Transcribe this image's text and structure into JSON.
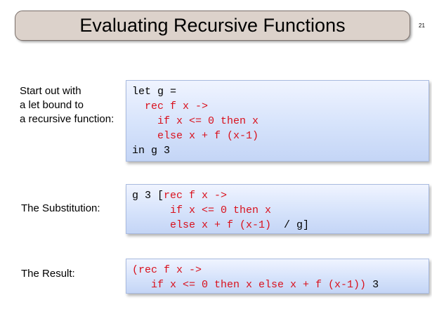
{
  "slide": {
    "title": "Evaluating Recursive Functions",
    "page_number": "21"
  },
  "section1": {
    "label_lines": [
      "Start out with",
      "a let bound to",
      "a recursive function:"
    ],
    "code": {
      "l1a": "let g =",
      "l2a": "  rec f x ->",
      "l3a": "    if x <= 0 then x",
      "l4a": "    else x + f (x-1)",
      "l5a": "in g 3"
    }
  },
  "section2": {
    "label": "The Substitution:",
    "code": {
      "l1a": "g 3 [",
      "l1b": "rec f x ->",
      "l2a": "      if x <= 0 then x",
      "l3a": "      else x + f (x-1)",
      "l3b": "  / g]"
    }
  },
  "section3": {
    "label": "The Result:",
    "code": {
      "l1a": "(rec f x ->",
      "l2a": "   if x <= 0 then x else x + f (x-1))",
      "l2b": " 3"
    }
  },
  "colors": {
    "title_bg": "#dcd2cb",
    "code_bg": "#d6e3fb",
    "code_red": "#d9101c"
  }
}
